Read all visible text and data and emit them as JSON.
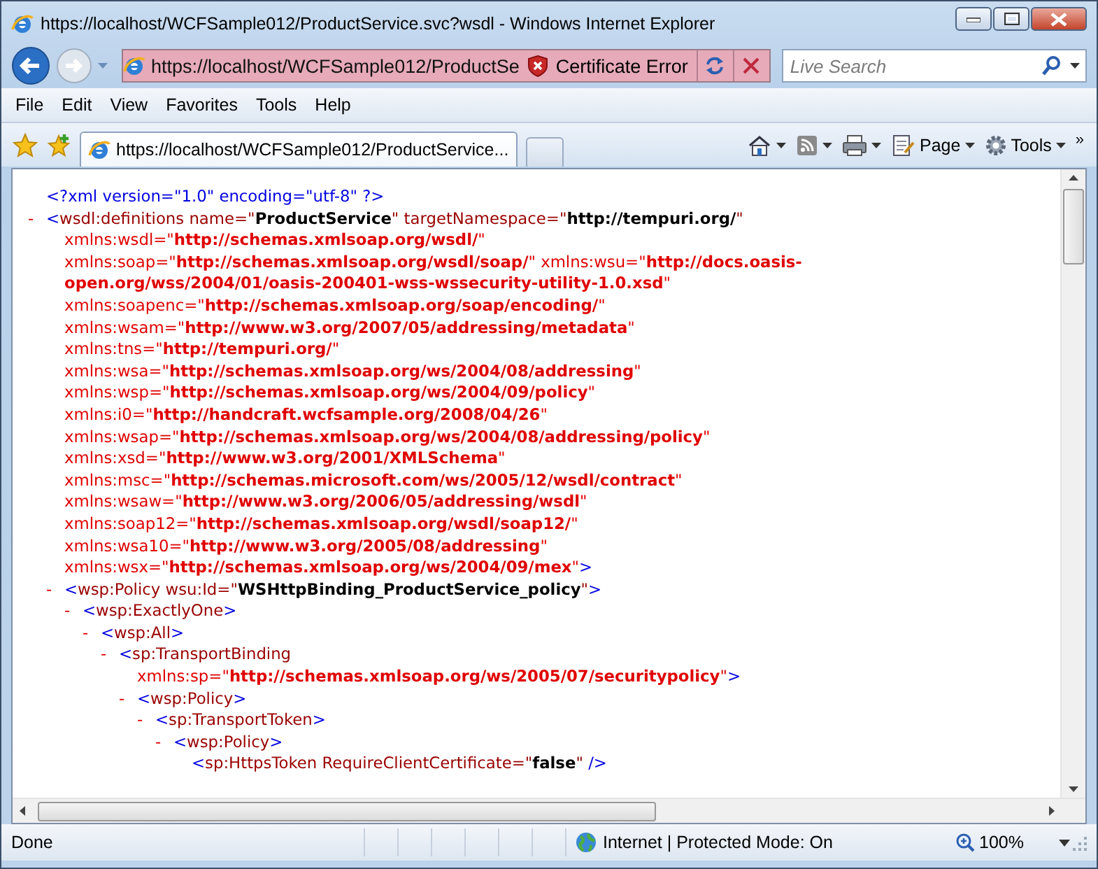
{
  "window": {
    "title": "https://localhost/WCFSample012/ProductService.svc?wsdl - Windows Internet Explorer"
  },
  "address_bar": {
    "url": "https://localhost/WCFSample012/ProductSe",
    "security": "Certificate Error"
  },
  "search": {
    "placeholder": "Live Search"
  },
  "menu": [
    "File",
    "Edit",
    "View",
    "Favorites",
    "Tools",
    "Help"
  ],
  "tabs": [
    {
      "label": "https://localhost/WCFSample012/ProductService...",
      "selected": true
    }
  ],
  "command_bar": {
    "page": "Page",
    "tools": "Tools",
    "overflow": "»"
  },
  "document": {
    "nodes": [
      {
        "head": [
          {
            "kind": "pi",
            "text": "<?xml version=\"1.0\" encoding=\"utf-8\" ?>"
          }
        ]
      },
      {
        "toggle": "-",
        "head": [
          {
            "kind": "markup",
            "text": "<"
          },
          {
            "kind": "tag",
            "text": "wsdl:definitions"
          },
          {
            "kind": "attr",
            "text": " name=\""
          },
          {
            "kind": "value",
            "text": "ProductService"
          },
          {
            "kind": "attr",
            "text": "\" targetNamespace=\""
          },
          {
            "kind": "value",
            "text": "http://tempuri.org/"
          },
          {
            "kind": "attr",
            "text": "\""
          }
        ],
        "attributes": [
          [
            {
              "kind": "ns",
              "text": "xmlns:wsdl=\""
            },
            {
              "kind": "ns_value",
              "text": "http://schemas.xmlsoap.org/wsdl/"
            },
            {
              "kind": "ns",
              "text": "\""
            }
          ],
          [
            {
              "kind": "ns",
              "text": "xmlns:soap=\""
            },
            {
              "kind": "ns_value",
              "text": "http://schemas.xmlsoap.org/wsdl/soap/"
            },
            {
              "kind": "ns",
              "text": "\" xmlns:wsu=\""
            },
            {
              "kind": "ns_value",
              "text": "http://docs.oasis-"
            }
          ],
          [
            {
              "kind": "ns_value",
              "text": "open.org/wss/2004/01/oasis-200401-wss-wssecurity-utility-1.0.xsd"
            },
            {
              "kind": "ns",
              "text": "\""
            }
          ],
          [
            {
              "kind": "ns",
              "text": "xmlns:soapenc=\""
            },
            {
              "kind": "ns_value",
              "text": "http://schemas.xmlsoap.org/soap/encoding/"
            },
            {
              "kind": "ns",
              "text": "\""
            }
          ],
          [
            {
              "kind": "ns",
              "text": "xmlns:wsam=\""
            },
            {
              "kind": "ns_value",
              "text": "http://www.w3.org/2007/05/addressing/metadata"
            },
            {
              "kind": "ns",
              "text": "\""
            }
          ],
          [
            {
              "kind": "ns",
              "text": "xmlns:tns=\""
            },
            {
              "kind": "ns_value",
              "text": "http://tempuri.org/"
            },
            {
              "kind": "ns",
              "text": "\""
            }
          ],
          [
            {
              "kind": "ns",
              "text": "xmlns:wsa=\""
            },
            {
              "kind": "ns_value",
              "text": "http://schemas.xmlsoap.org/ws/2004/08/addressing"
            },
            {
              "kind": "ns",
              "text": "\""
            }
          ],
          [
            {
              "kind": "ns",
              "text": "xmlns:wsp=\""
            },
            {
              "kind": "ns_value",
              "text": "http://schemas.xmlsoap.org/ws/2004/09/policy"
            },
            {
              "kind": "ns",
              "text": "\""
            }
          ],
          [
            {
              "kind": "ns",
              "text": "xmlns:i0=\""
            },
            {
              "kind": "ns_value",
              "text": "http://handcraft.wcfsample.org/2008/04/26"
            },
            {
              "kind": "ns",
              "text": "\""
            }
          ],
          [
            {
              "kind": "ns",
              "text": "xmlns:wsap=\""
            },
            {
              "kind": "ns_value",
              "text": "http://schemas.xmlsoap.org/ws/2004/08/addressing/policy"
            },
            {
              "kind": "ns",
              "text": "\""
            }
          ],
          [
            {
              "kind": "ns",
              "text": "xmlns:xsd=\""
            },
            {
              "kind": "ns_value",
              "text": "http://www.w3.org/2001/XMLSchema"
            },
            {
              "kind": "ns",
              "text": "\""
            }
          ],
          [
            {
              "kind": "ns",
              "text": "xmlns:msc=\""
            },
            {
              "kind": "ns_value",
              "text": "http://schemas.microsoft.com/ws/2005/12/wsdl/contract"
            },
            {
              "kind": "ns",
              "text": "\""
            }
          ],
          [
            {
              "kind": "ns",
              "text": "xmlns:wsaw=\""
            },
            {
              "kind": "ns_value",
              "text": "http://www.w3.org/2006/05/addressing/wsdl"
            },
            {
              "kind": "ns",
              "text": "\""
            }
          ],
          [
            {
              "kind": "ns",
              "text": "xmlns:soap12=\""
            },
            {
              "kind": "ns_value",
              "text": "http://schemas.xmlsoap.org/wsdl/soap12/"
            },
            {
              "kind": "ns",
              "text": "\""
            }
          ],
          [
            {
              "kind": "ns",
              "text": "xmlns:wsa10=\""
            },
            {
              "kind": "ns_value",
              "text": "http://www.w3.org/2005/08/addressing"
            },
            {
              "kind": "ns",
              "text": "\""
            }
          ],
          [
            {
              "kind": "ns",
              "text": "xmlns:wsx=\""
            },
            {
              "kind": "ns_value",
              "text": "http://schemas.xmlsoap.org/ws/2004/09/mex"
            },
            {
              "kind": "ns",
              "text": "\""
            },
            {
              "kind": "markup",
              "text": ">"
            }
          ]
        ],
        "children": [
          {
            "toggle": "-",
            "head": [
              {
                "kind": "markup",
                "text": "<"
              },
              {
                "kind": "tag",
                "text": "wsp:Policy"
              },
              {
                "kind": "attr",
                "text": " wsu:Id=\""
              },
              {
                "kind": "value",
                "text": "WSHttpBinding_ProductService_policy"
              },
              {
                "kind": "attr",
                "text": "\""
              },
              {
                "kind": "markup",
                "text": ">"
              }
            ],
            "children": [
              {
                "toggle": "-",
                "head": [
                  {
                    "kind": "markup",
                    "text": "<"
                  },
                  {
                    "kind": "tag",
                    "text": "wsp:ExactlyOne"
                  },
                  {
                    "kind": "markup",
                    "text": ">"
                  }
                ],
                "children": [
                  {
                    "toggle": "-",
                    "head": [
                      {
                        "kind": "markup",
                        "text": "<"
                      },
                      {
                        "kind": "tag",
                        "text": "wsp:All"
                      },
                      {
                        "kind": "markup",
                        "text": ">"
                      }
                    ],
                    "children": [
                      {
                        "toggle": "-",
                        "head": [
                          {
                            "kind": "markup",
                            "text": "<"
                          },
                          {
                            "kind": "tag",
                            "text": "sp:TransportBinding"
                          }
                        ],
                        "attributes": [
                          [
                            {
                              "kind": "ns",
                              "text": "xmlns:sp=\""
                            },
                            {
                              "kind": "ns_value",
                              "text": "http://schemas.xmlsoap.org/ws/2005/07/securitypolicy"
                            },
                            {
                              "kind": "ns",
                              "text": "\""
                            },
                            {
                              "kind": "markup",
                              "text": ">"
                            }
                          ]
                        ],
                        "children": [
                          {
                            "toggle": "-",
                            "head": [
                              {
                                "kind": "markup",
                                "text": "<"
                              },
                              {
                                "kind": "tag",
                                "text": "wsp:Policy"
                              },
                              {
                                "kind": "markup",
                                "text": ">"
                              }
                            ],
                            "children": [
                              {
                                "toggle": "-",
                                "head": [
                                  {
                                    "kind": "markup",
                                    "text": "<"
                                  },
                                  {
                                    "kind": "tag",
                                    "text": "sp:TransportToken"
                                  },
                                  {
                                    "kind": "markup",
                                    "text": ">"
                                  }
                                ],
                                "children": [
                                  {
                                    "toggle": "-",
                                    "head": [
                                      {
                                        "kind": "markup",
                                        "text": "<"
                                      },
                                      {
                                        "kind": "tag",
                                        "text": "wsp:Policy"
                                      },
                                      {
                                        "kind": "markup",
                                        "text": ">"
                                      }
                                    ],
                                    "children": [
                                      {
                                        "head": [
                                          {
                                            "kind": "markup",
                                            "text": "<"
                                          },
                                          {
                                            "kind": "tag",
                                            "text": "sp:HttpsToken"
                                          },
                                          {
                                            "kind": "attr",
                                            "text": " RequireClientCertificate=\""
                                          },
                                          {
                                            "kind": "value",
                                            "text": "false"
                                          },
                                          {
                                            "kind": "attr",
                                            "text": "\""
                                          },
                                          {
                                            "kind": "markup",
                                            "text": " />"
                                          }
                                        ]
                                      }
                                    ]
                                  }
                                ]
                              }
                            ]
                          }
                        ]
                      }
                    ]
                  }
                ]
              }
            ]
          }
        ]
      }
    ]
  },
  "status_bar": {
    "text": "Done",
    "zone": "Internet | Protected Mode: On",
    "zoom": "100%"
  }
}
